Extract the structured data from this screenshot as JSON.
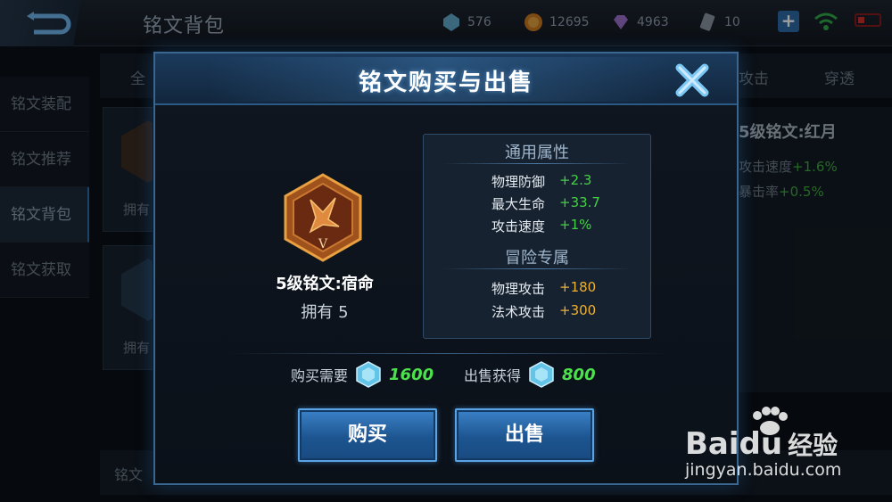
{
  "topbar": {
    "title": "铭文背包",
    "resources": [
      {
        "icon": "diamond-icon",
        "value": "576"
      },
      {
        "icon": "gold-coin-icon",
        "value": "12695"
      },
      {
        "icon": "gem-icon",
        "value": "4963"
      },
      {
        "icon": "ticket-icon",
        "value": "10"
      }
    ]
  },
  "sidebar": {
    "items": [
      {
        "label": "铭文装配"
      },
      {
        "label": "铭文推荐"
      },
      {
        "label": "铭文背包"
      },
      {
        "label": "铭文获取"
      }
    ]
  },
  "filters": {
    "all": "全",
    "attack": "攻击",
    "pierce": "穿透"
  },
  "background_cards": [
    {
      "label": "拥有"
    },
    {
      "label": "拥有"
    }
  ],
  "right_panel": {
    "title": "5级铭文:红月",
    "lines": [
      {
        "key": "攻击速度",
        "value": "+1.6%"
      },
      {
        "key": "暴击率",
        "value": "+0.5%"
      }
    ]
  },
  "bottom_bar": {
    "label": "铭文"
  },
  "dialog": {
    "title": "铭文购买与出售",
    "item": {
      "name": "5级铭文:宿命",
      "owned": "拥有 5",
      "level_mark": "V"
    },
    "general_section": {
      "title": "通用属性",
      "attrs": [
        {
          "key": "物理防御",
          "value": "+2.3"
        },
        {
          "key": "最大生命",
          "value": "+33.7"
        },
        {
          "key": "攻击速度",
          "value": "+1%"
        }
      ]
    },
    "adventure_section": {
      "title": "冒险专属",
      "attrs": [
        {
          "key": "物理攻击",
          "value": "+180"
        },
        {
          "key": "法术攻击",
          "value": "+300"
        }
      ]
    },
    "buy_price_label": "购买需要",
    "buy_price": "1600",
    "sell_price_label": "出售获得",
    "sell_price": "800",
    "buy_button": "购买",
    "sell_button": "出售"
  },
  "watermark": {
    "brand": "Bai",
    "brand2": "du",
    "cn": "经验",
    "url": "jingyan.baidu.com"
  },
  "colors": {
    "positive": "#44d044",
    "adventure": "#f0b030",
    "accent": "#3b82c8"
  }
}
